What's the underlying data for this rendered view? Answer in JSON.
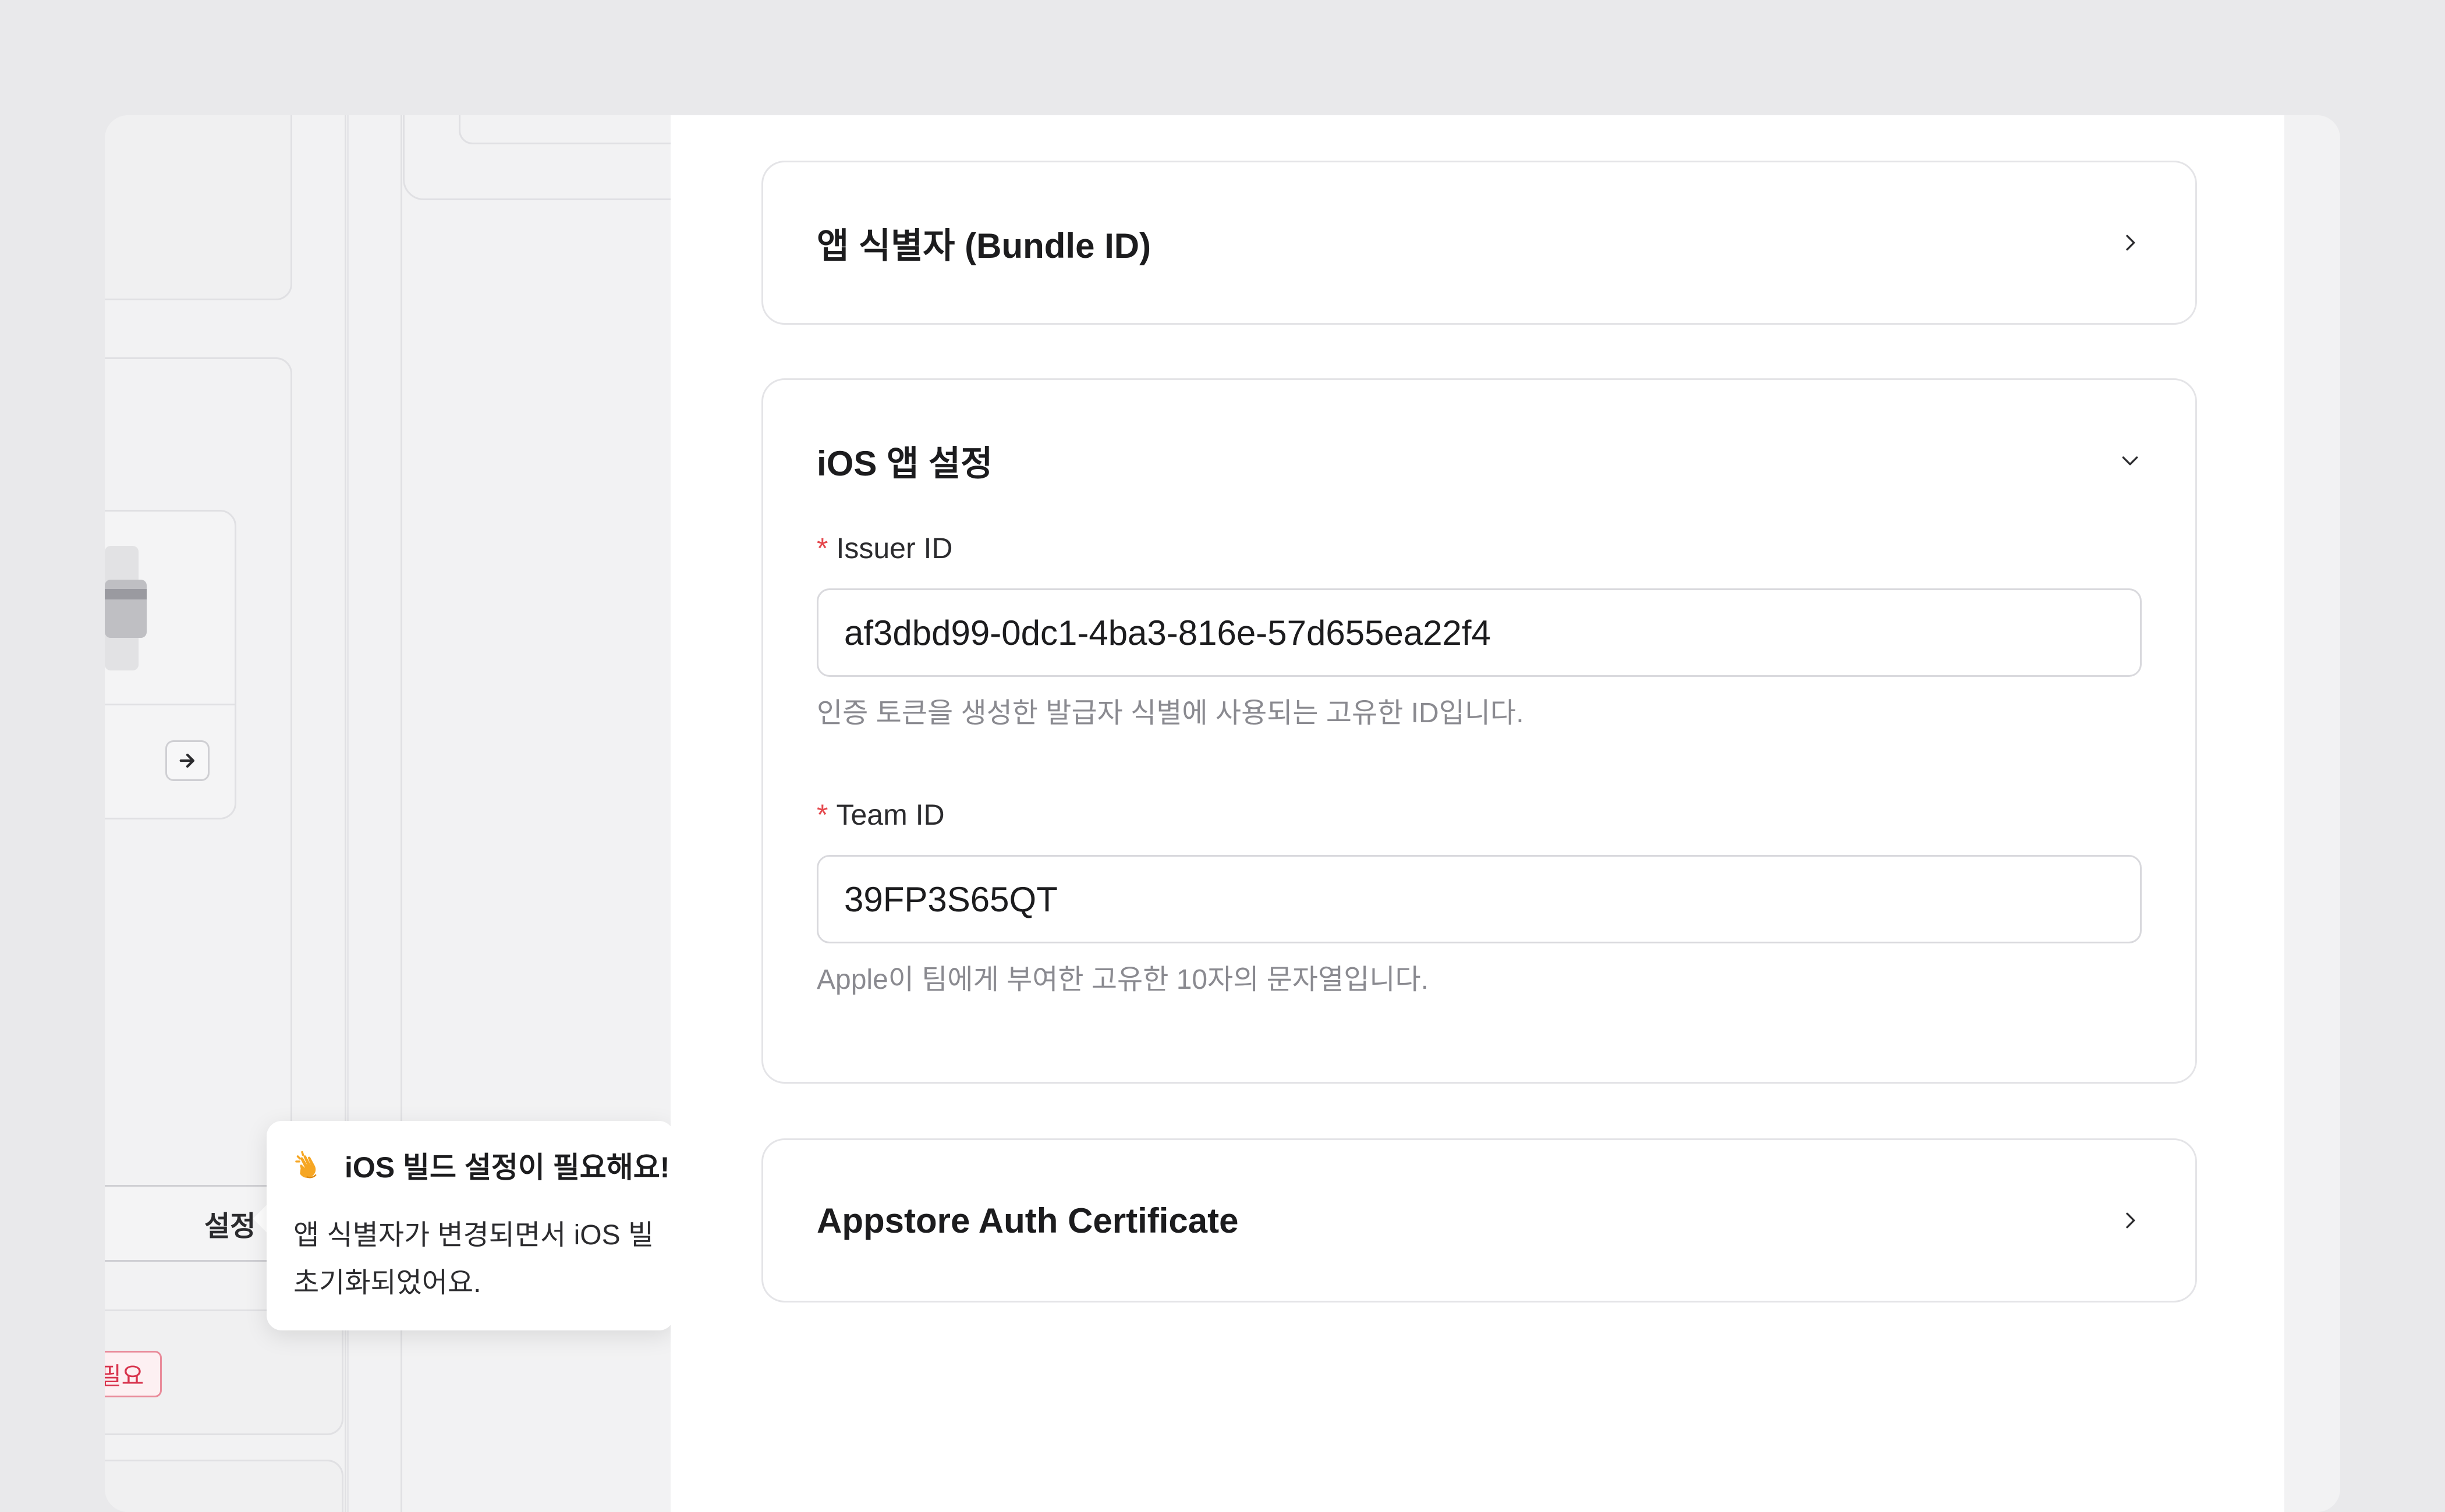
{
  "background_app": {
    "open_settings_label": "설정 열기",
    "status_badge": "필요"
  },
  "tooltip": {
    "title": "iOS 빌드 설정이 필요해요!",
    "body_line1": "앱 식별자가 변경되면서 iOS 빌",
    "body_line2": "초기화되었어요."
  },
  "sections": {
    "bundle_id": {
      "title": "앱 식별자 (Bundle ID)",
      "expanded": false
    },
    "ios_settings": {
      "title": "iOS 앱 설정",
      "expanded": true,
      "issuer": {
        "required_mark": "*",
        "label": "Issuer ID",
        "value": "af3dbd99-0dc1-4ba3-816e-57d655ea22f4",
        "help": "인증 토큰을 생성한 발급자 식별에 사용되는 고유한 ID입니다."
      },
      "team": {
        "required_mark": "*",
        "label": "Team ID",
        "value": "39FP3S65QT",
        "help": "Apple이 팀에게 부여한 고유한 10자의 문자열입니다."
      }
    },
    "appstore_cert": {
      "title": "Appstore Auth Certificate",
      "expanded": false
    }
  },
  "colors": {
    "required": "#e5484d",
    "badge_text": "#d8344d",
    "clap_icon": "#f6a623"
  },
  "icons": {
    "clap": "clapping-hands-icon",
    "chevron_right": "chevron-right-icon",
    "chevron_down": "chevron-down-icon",
    "arrow_right": "arrow-right-icon"
  }
}
